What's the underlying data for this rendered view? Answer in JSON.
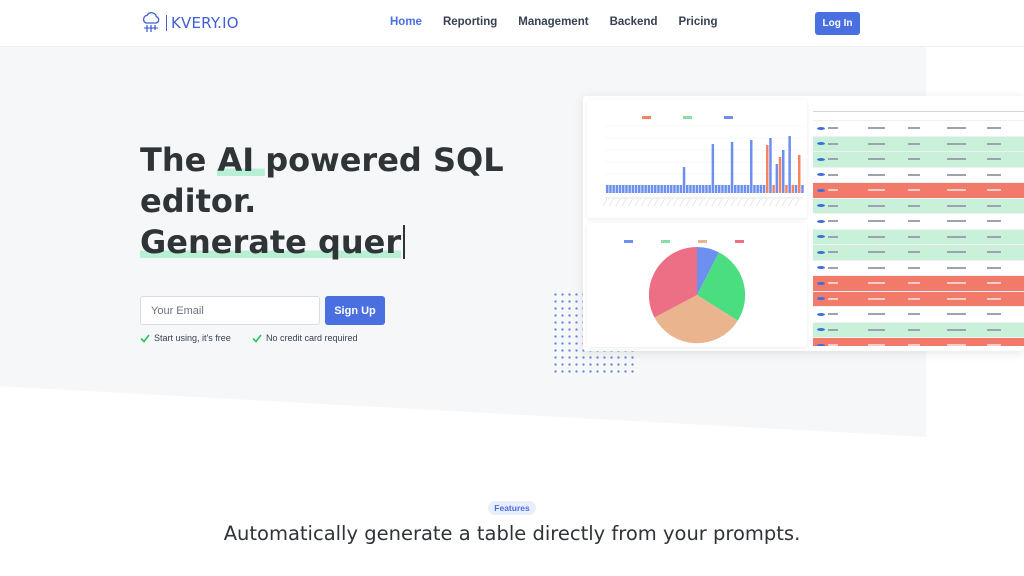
{
  "nav": {
    "logo_text": "KVERY.IO",
    "links": [
      "Home",
      "Reporting",
      "Management",
      "Backend",
      "Pricing"
    ],
    "login_label": "Log In"
  },
  "hero": {
    "line1_a": "The ",
    "line1_hl": "AI ",
    "line1_b": "powered SQL",
    "line2": "editor.",
    "line3": "Generate quer",
    "email_placeholder": "Your Email",
    "signup_label": "Sign Up",
    "perks": [
      "Start using, it's free",
      "No credit card required"
    ]
  },
  "colors": {
    "accent": "#4a6fe0",
    "highlight": "#b9efd4",
    "row_green": "#c9f0d9",
    "row_red": "#f27a6a"
  },
  "features": {
    "badge": "Features",
    "title": "Automatically generate a table directly from your prompts."
  }
}
